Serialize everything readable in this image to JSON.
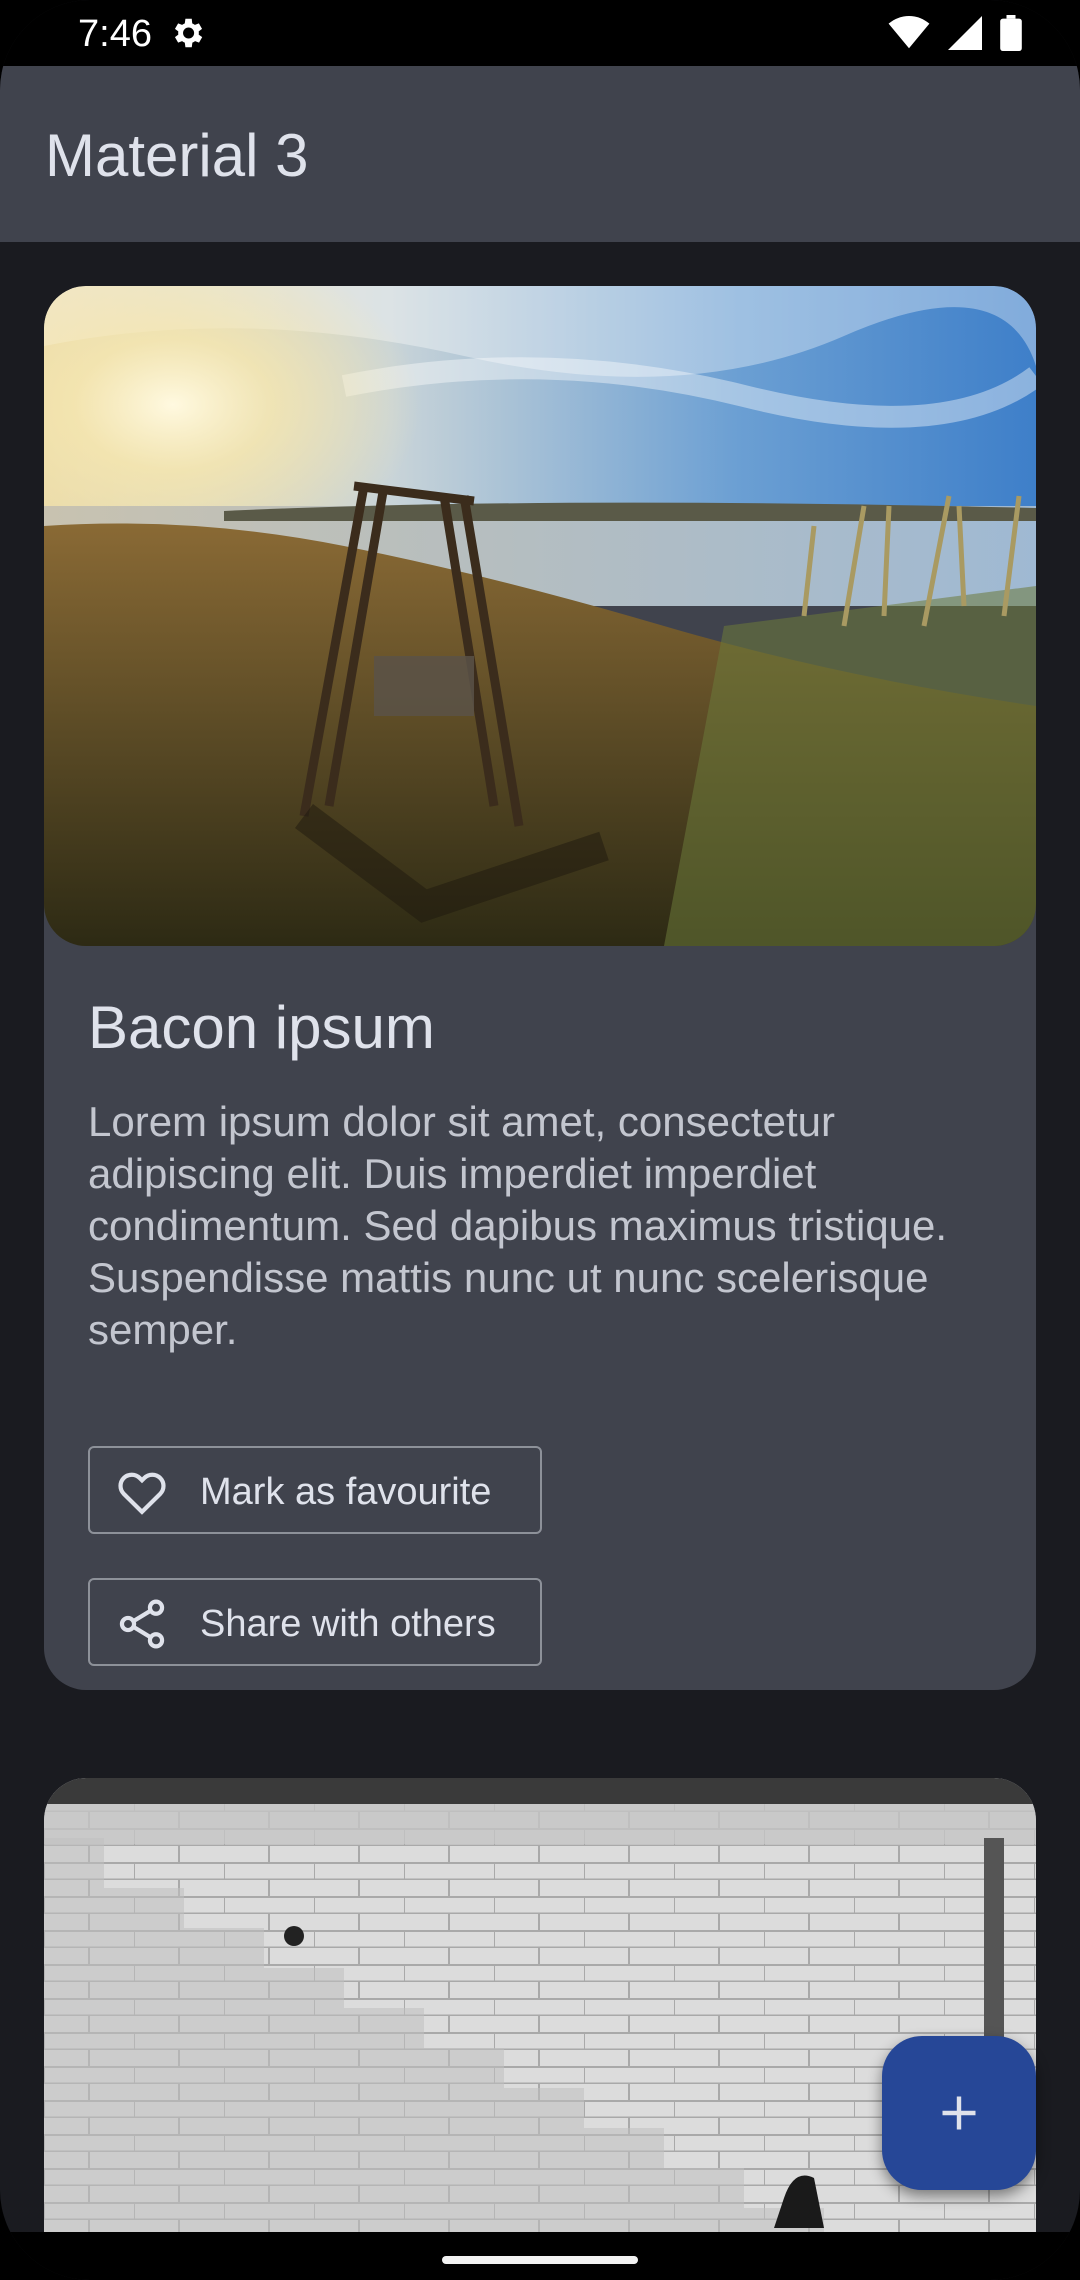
{
  "status_bar": {
    "time": "7:46",
    "icons": [
      "settings-icon",
      "wifi-icon",
      "cellular-icon",
      "battery-icon"
    ]
  },
  "app_bar": {
    "title": "Material 3"
  },
  "cards": [
    {
      "title": "Bacon ipsum",
      "body": "Lorem ipsum dolor sit amet, consectetur adipiscing elit. Duis imperdiet imperdiet condimentum. Sed dapibus maximus tristique. Suspendisse mattis nunc ut nunc scelerisque semper.",
      "actions": [
        {
          "label": "Mark as favourite",
          "icon": "heart-outline-icon"
        },
        {
          "label": "Share with others",
          "icon": "share-icon"
        }
      ],
      "image": "landscape-swing-by-lake"
    },
    {
      "image": "stone-wall-stairs"
    }
  ],
  "fab": {
    "icon": "plus-icon"
  },
  "colors": {
    "background": "#1a1b20",
    "surface": "#40434d",
    "on_surface": "#dfe2eb",
    "on_surface_variant": "#c3c6cf",
    "outline": "#8d9199",
    "fab": "#264797"
  }
}
